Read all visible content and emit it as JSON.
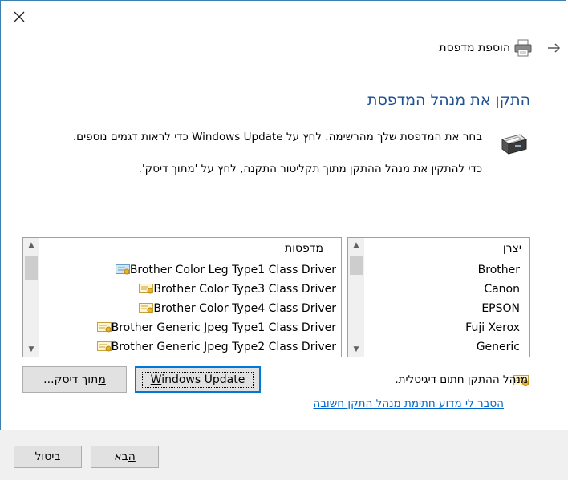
{
  "wizard": {
    "title": "הוספת מדפסת",
    "heading": "התקן את מנהל המדפסת",
    "line1": "בחר את המדפסת שלך מהרשימה. לחץ על Windows Update כדי לראות דגמים נוספים.",
    "line2": "כדי להתקין את מנהל ההתקן מתוך תקליטור התקנה, לחץ על 'מתוך דיסק'."
  },
  "manufacturers": {
    "header": "יצרן",
    "items": [
      "Brother",
      "Canon",
      "EPSON",
      "Fuji Xerox",
      "Generic"
    ],
    "selected_index": 0
  },
  "printers": {
    "header": "מדפסות",
    "items": [
      "Brother Color Leg Type1 Class Driver",
      "Brother Color Type3 Class Driver",
      "Brother Color Type4 Class Driver",
      "Brother Generic Jpeg Type1 Class Driver",
      "Brother Generic Jpeg Type2 Class Driver"
    ],
    "selected_index": 0
  },
  "buttons": {
    "windows_update": "Windows Update",
    "windows_update_mnemonic": "W",
    "windows_update_rest": "indows Update",
    "have_disk_mnemonic": "מ",
    "have_disk_rest": "תוך דיסק...",
    "next_mnemonic": "ה",
    "next_rest": "בא",
    "cancel": "ביטול"
  },
  "signed_text": "מנהל ההתקן חתום דיגיטלית.",
  "signing_link": "הסבר לי מדוע חתימת מנהל התקן חשובה",
  "icons": {
    "close": "close-icon",
    "back": "back-arrow-icon",
    "printer": "printer-icon",
    "certificate": "certificate-icon"
  },
  "colors": {
    "heading": "#1d4f91",
    "link": "#0066cc",
    "accent": "#0078d7",
    "footer": "#f0f0f0"
  }
}
